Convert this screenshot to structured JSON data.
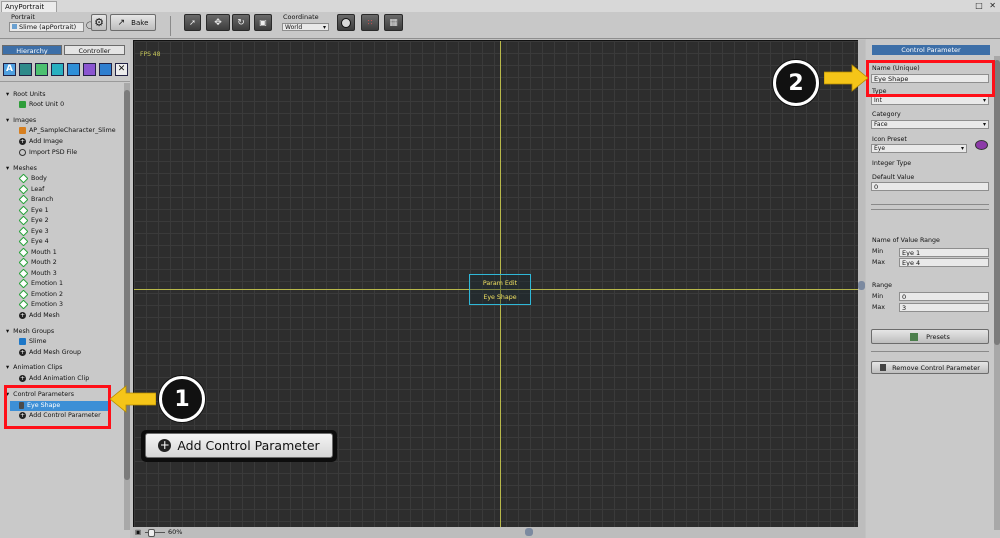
{
  "window": {
    "tab_title": "AnyPortrait",
    "controls": "□ ✕"
  },
  "toolbar": {
    "portrait_label": "Portrait",
    "portrait_value": "Slime (apPortrait)",
    "bake_label": "Bake",
    "coordinate_label": "Coordinate",
    "coordinate_value": "World"
  },
  "left_panel": {
    "tabs": [
      {
        "label": "Hierarchy"
      },
      {
        "label": "Controller"
      }
    ],
    "sections": {
      "root_units": {
        "title": "Root Units",
        "items": [
          "Root Unit 0"
        ]
      },
      "images": {
        "title": "Images",
        "items": [
          "AP_SampleCharacter_Slime",
          "Add Image",
          "Import PSD File"
        ]
      },
      "meshes": {
        "title": "Meshes",
        "items": [
          "Body",
          "Leaf",
          "Branch",
          "Eye 1",
          "Eye 2",
          "Eye 3",
          "Eye 4",
          "Mouth 1",
          "Mouth 2",
          "Mouth 3",
          "Emotion 1",
          "Emotion 2",
          "Emotion 3",
          "Add Mesh"
        ]
      },
      "mesh_groups": {
        "title": "Mesh Groups",
        "items": [
          "Slime",
          "Add Mesh Group"
        ]
      },
      "animation_clips": {
        "title": "Animation Clips",
        "items": [
          "Add Animation Clip"
        ]
      },
      "control_parameters": {
        "title": "Control Parameters",
        "items": [
          "Eye Shape",
          "Add Control Parameter"
        ]
      }
    }
  },
  "canvas": {
    "fps_text": "FPS 48",
    "overlay_title": "Param Edit",
    "overlay_name": "Eye Shape",
    "zoom_text": "60%",
    "callout_button_label": "Add Control Parameter"
  },
  "right_panel": {
    "header": "Control Parameter",
    "name_label": "Name (Unique)",
    "name_value": "Eye Shape",
    "type_label": "Type",
    "type_value": "Int",
    "category_label": "Category",
    "category_value": "Face",
    "icon_preset_label": "Icon Preset",
    "icon_preset_value": "Eye",
    "integer_type_label": "Integer Type",
    "default_value_label": "Default Value",
    "default_value": "0",
    "value_range_name_label": "Name of Value Range",
    "min_label": "Min",
    "min_name": "Eye 1",
    "max_label": "Max",
    "max_name": "Eye 4",
    "range_label": "Range",
    "range_min_label": "Min",
    "range_min": "0",
    "range_max_label": "Max",
    "range_max": "3",
    "presets_label": "Presets",
    "remove_label": "Remove Control Parameter"
  },
  "annotations": {
    "marker_1": "1",
    "marker_2": "2"
  },
  "colors": {
    "highlight_red": "#ff0f18",
    "arrow_yellow": "#f5c518",
    "selection_blue": "#3d8fd6",
    "canvas_bg": "#2d2d2d",
    "guide_yellow": "#b8b84a"
  }
}
